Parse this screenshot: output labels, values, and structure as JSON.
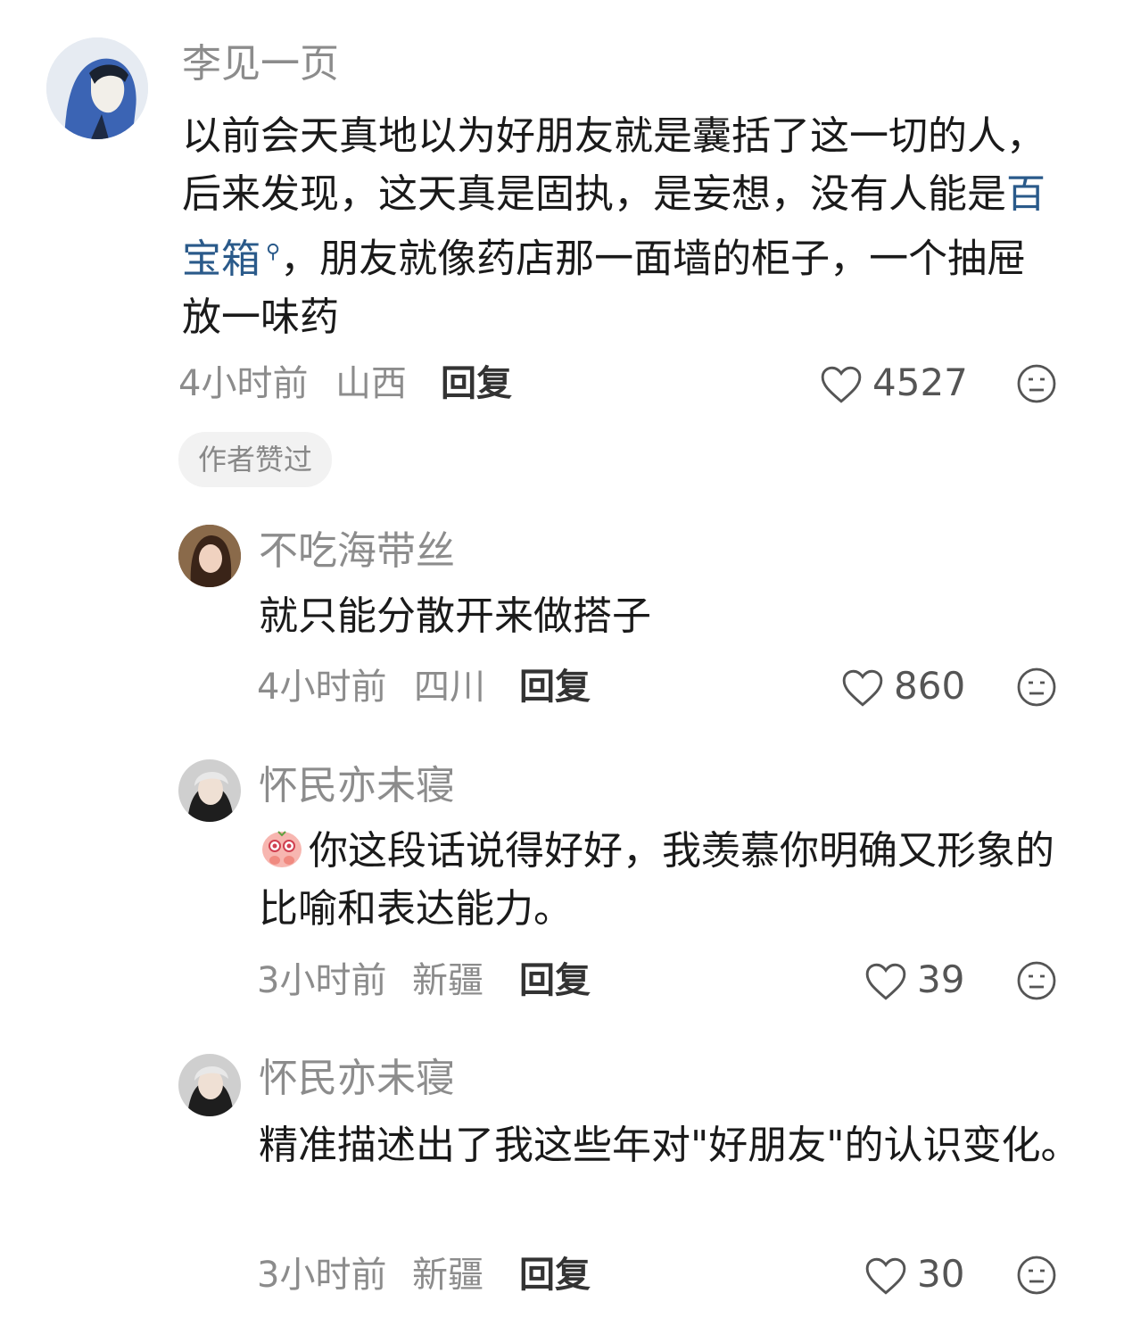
{
  "comments": [
    {
      "user": "李见一页",
      "text_pre": "以前会天真地以为好朋友就是囊括了这一切的人，后来发现，这天真是固执，是妄想，没有人能是",
      "link": "百宝箱",
      "text_post": "，朋友就像药店那一面墙的柜子，一个抽屉放一味药",
      "time": "4小时前",
      "location": "山西",
      "reply": "回复",
      "likes": "4527",
      "badge": "作者赞过"
    },
    {
      "user": "不吃海带丝",
      "text": "就只能分散开来做搭子",
      "time": "4小时前",
      "location": "四川",
      "reply": "回复",
      "likes": "860"
    },
    {
      "user": "怀民亦未寝",
      "text": "你这段话说得好好，我羡慕你明确又形象的比喻和表达能力。",
      "time": "3小时前",
      "location": "新疆",
      "reply": "回复",
      "likes": "39"
    },
    {
      "user": "怀民亦未寝",
      "text": "精准描述出了我这些年对\"好朋友\"的认识变化。",
      "time": "3小时前",
      "location": "新疆",
      "reply": "回复",
      "likes": "30"
    }
  ]
}
